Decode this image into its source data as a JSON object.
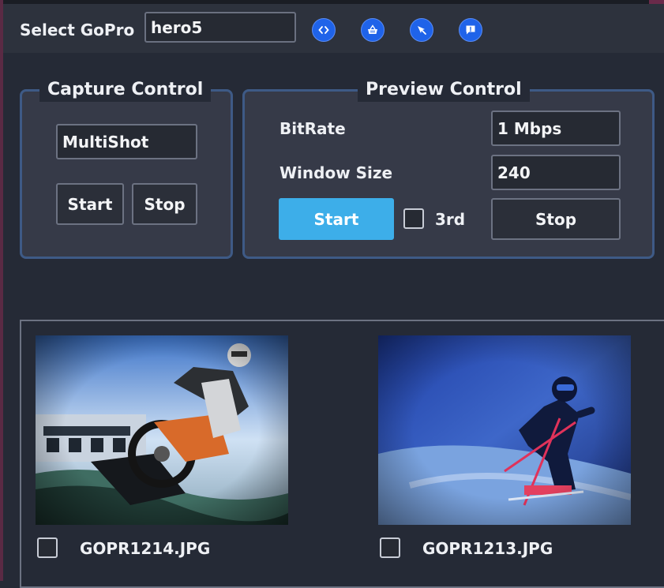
{
  "toolbar": {
    "label": "Select GoPro",
    "camera_value": "hero5",
    "icons": [
      "code-icon",
      "basket-icon",
      "cursor-icon",
      "message-icon"
    ]
  },
  "capture": {
    "title": "Capture Control",
    "mode_value": "MultiShot",
    "start_label": "Start",
    "stop_label": "Stop"
  },
  "preview": {
    "title": "Preview Control",
    "bitrate_label": "BitRate",
    "bitrate_value": "1 Mbps",
    "window_label": "Window Size",
    "window_value": "240",
    "start_label": "Start",
    "third_label": "3rd",
    "third_checked": false,
    "stop_label": "Stop"
  },
  "gallery": {
    "items": [
      {
        "filename": "GOPR1214.JPG",
        "checked": false
      },
      {
        "filename": "GOPR1213.JPG",
        "checked": false
      }
    ]
  },
  "colors": {
    "background": "#252a36",
    "toolbar": "#2d323d",
    "accent": "#3daee9",
    "group_border": "#3e5a86",
    "icon_button": "#1f63e9"
  }
}
